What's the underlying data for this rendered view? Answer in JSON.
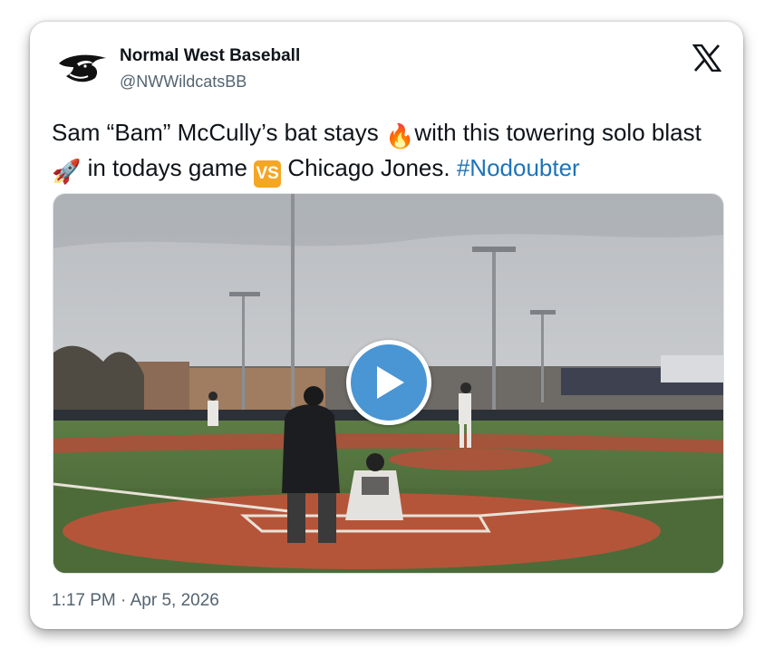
{
  "author": {
    "name": "Normal West Baseball",
    "handle": "@NWWildcatsBB",
    "avatar_icon": "wildcat-logo-icon"
  },
  "platform_icon": "x-logo-icon",
  "tweet": {
    "text_1": "Sam “Bam” McCully’s bat stays ",
    "emoji_fire": "🔥",
    "text_2": "with this towering solo blast ",
    "emoji_rocket": "🚀",
    "text_3": " in todays game ",
    "vs_label": "VS",
    "text_4": " Chicago Jones.  ",
    "hashtag": "#Nodoubter"
  },
  "media": {
    "type": "video",
    "play_icon": "play-icon"
  },
  "timestamp": "1:17 PM · Apr 5, 2026",
  "colors": {
    "hashtag": "#1d74b9",
    "play_button": "#4a95d4",
    "vs_badge": "#f5a623",
    "meta_text": "#536471"
  }
}
